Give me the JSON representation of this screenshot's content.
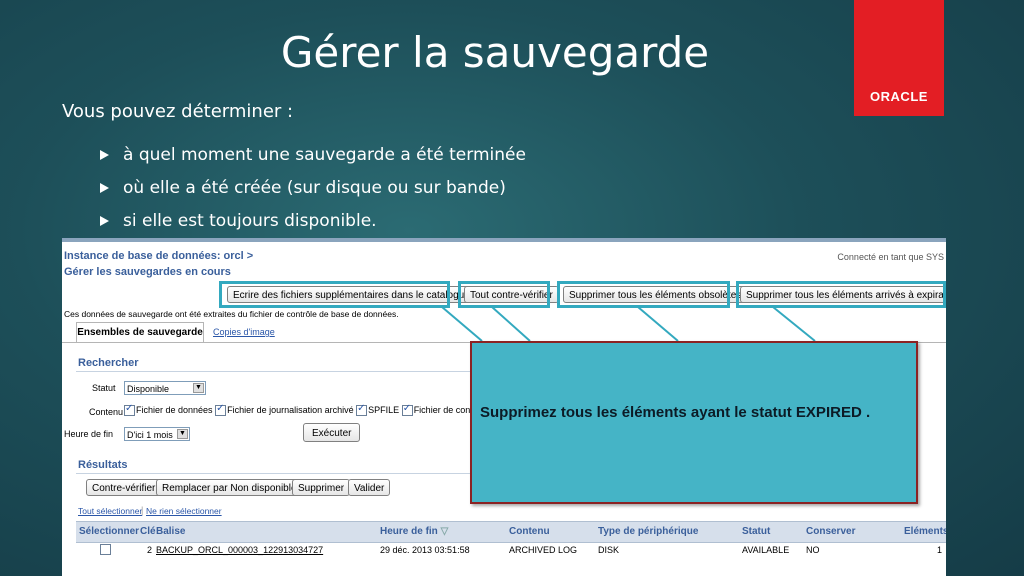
{
  "slide": {
    "title": "Gérer la sauvegarde",
    "brand": "ORACLE",
    "intro": "Vous pouvez déterminer :",
    "bullets": [
      "à quel moment une sauvegarde a été terminée",
      "où elle a été créée (sur disque ou sur bande)",
      "si elle est toujours disponible."
    ]
  },
  "app": {
    "breadcrumb": "Instance de base de données: orcl  >",
    "page_title": "Gérer les sauvegardes en cours",
    "connected": "Connecté en tant que SYS",
    "info_text": "Ces données de sauvegarde ont été extraites du fichier de contrôle de base de données.",
    "top_buttons": [
      "Ecrire des fichiers supplémentaires dans le catalogue",
      "Tout contre-vérifier",
      "Supprimer tous les éléments obsolètes",
      "Supprimer tous les éléments arrivés à expiration"
    ],
    "tabs": [
      "Ensembles de sauvegarde",
      "Copies d'image"
    ],
    "search": {
      "heading": "Rechercher",
      "statut_label": "Statut",
      "statut_value": "Disponible",
      "contenu_label": "Contenu",
      "content_options": [
        "Fichier de données",
        "Fichier de journalisation archivé",
        "SPFILE",
        "Fichier de contrôle"
      ],
      "heure_label": "Heure de fin",
      "heure_value": "D'ici 1 mois",
      "execute": "Exécuter"
    },
    "results": {
      "heading": "Résultats",
      "buttons": [
        "Contre-vérifier",
        "Remplacer par Non disponible",
        "Supprimer",
        "Valider"
      ],
      "select_all": "Tout sélectionner",
      "select_none": "Ne rien sélectionner",
      "columns": [
        "Sélectionner",
        "Clé",
        "Balise",
        "Heure de fin",
        "Contenu",
        "Type de périphérique",
        "Statut",
        "Conserver",
        "Eléments"
      ],
      "rows": [
        {
          "key": "2",
          "tag": "BACKUP_ORCL_000003_122913034727",
          "end_time": "29 déc. 2013 03:51:58",
          "content": "ARCHIVED LOG",
          "device": "DISK",
          "status": "AVAILABLE",
          "keep": "NO",
          "pieces": "1"
        }
      ]
    }
  },
  "callout": {
    "text": "Supprimez tous les éléments ayant le statut EXPIRED ."
  },
  "colors": {
    "oracle_red": "#e31e24",
    "highlight": "#33a9bf",
    "callout_bg": "#45b4c6",
    "callout_border": "#8b2323"
  }
}
